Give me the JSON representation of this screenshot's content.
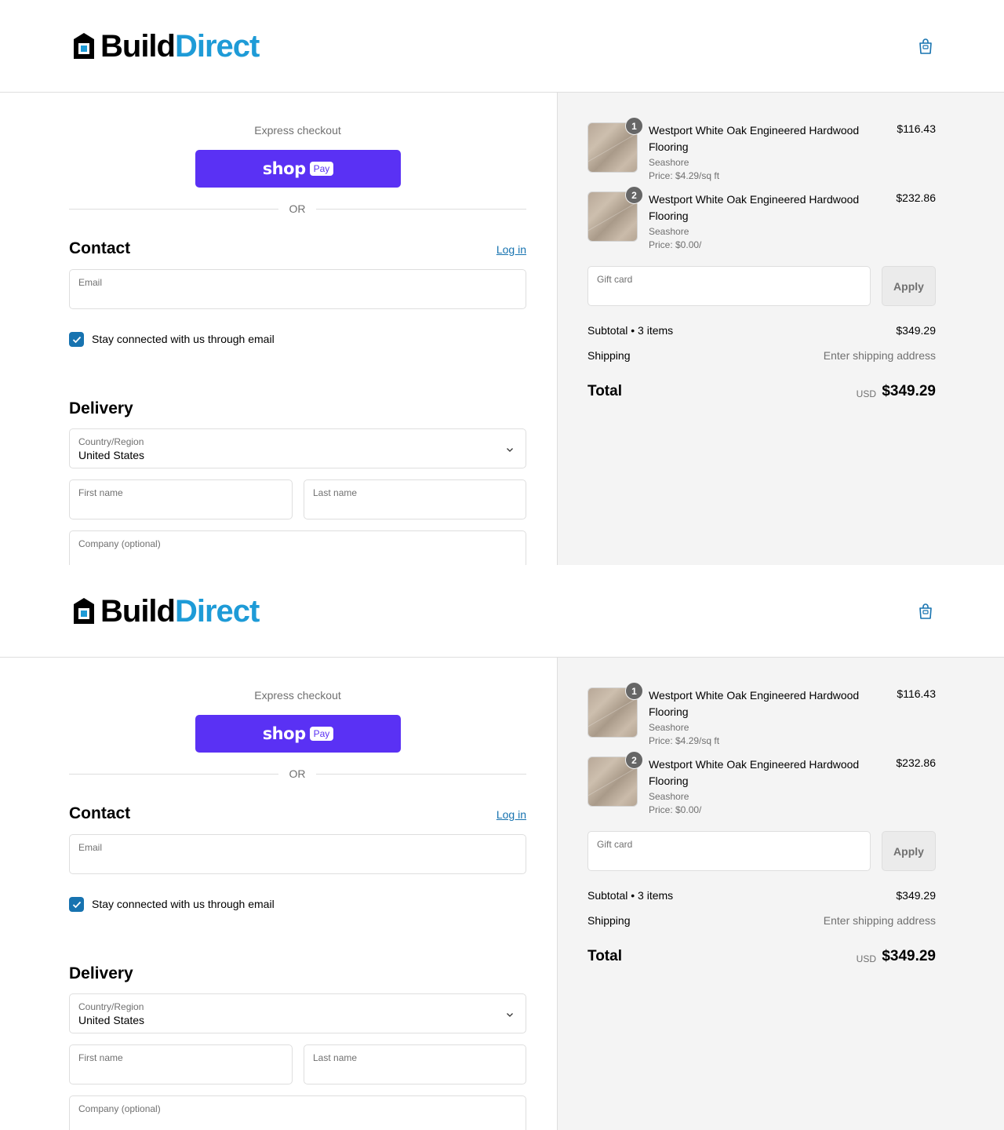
{
  "brand": {
    "part1": "Build",
    "part2": "Direct",
    "accent": "#1e9bd7",
    "link_color": "#1773b0",
    "shop_pay_color": "#5a31f4"
  },
  "express": {
    "label": "Express checkout",
    "shop_word": "shop",
    "pay_word": "Pay",
    "or_label": "OR"
  },
  "contact": {
    "heading": "Contact",
    "login_label": "Log in",
    "email_label": "Email",
    "email_value": "",
    "newsletter_label": "Stay connected with us through email",
    "newsletter_checked": true
  },
  "delivery": {
    "heading": "Delivery",
    "country_label": "Country/Region",
    "country_value": "United States",
    "first_name_label": "First name",
    "last_name_label": "Last name",
    "company_label": "Company (optional)"
  },
  "order": {
    "items": [
      {
        "qty": "1",
        "title": "Westport White Oak Engineered Hardwood Flooring",
        "variant": "Seashore",
        "unit_price": "Price: $4.29/sq ft",
        "price": "$116.43"
      },
      {
        "qty": "2",
        "title": "Westport White Oak Engineered Hardwood Flooring",
        "variant": "Seashore",
        "unit_price": "Price: $0.00/",
        "price": "$232.86"
      }
    ],
    "gift_label": "Gift card",
    "apply_label": "Apply",
    "subtotal_label": "Subtotal • 3 items",
    "subtotal_value": "$349.29",
    "shipping_label": "Shipping",
    "shipping_value": "Enter shipping address",
    "total_label": "Total",
    "currency": "USD",
    "total_value": "$349.29"
  }
}
